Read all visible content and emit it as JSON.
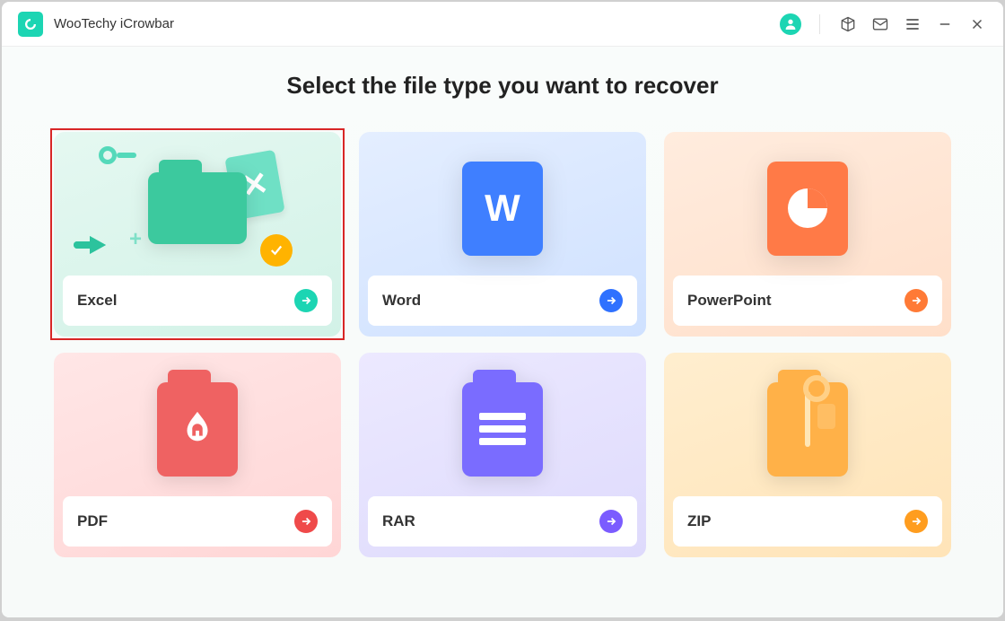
{
  "app": {
    "title": "WooTechy iCrowbar"
  },
  "heading": "Select the file type you want to recover",
  "cards": {
    "excel": {
      "label": "Excel"
    },
    "word": {
      "label": "Word"
    },
    "ppt": {
      "label": "PowerPoint"
    },
    "pdf": {
      "label": "PDF"
    },
    "rar": {
      "label": "RAR"
    },
    "zip": {
      "label": "ZIP"
    }
  }
}
